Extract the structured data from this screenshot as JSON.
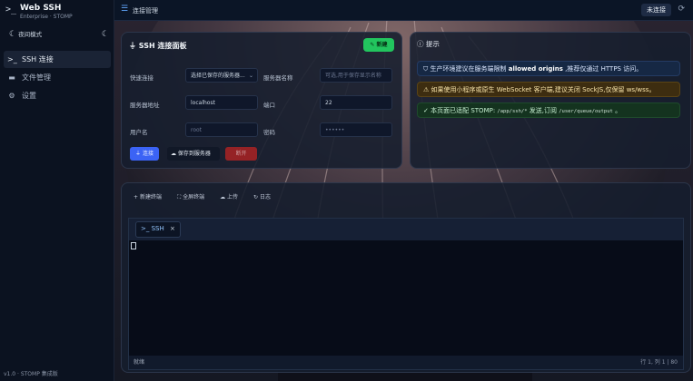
{
  "app": {
    "title": "Web SSH",
    "subtitle": "Enterprise · STOMP",
    "logo_icon": "terminal-icon",
    "theme_label": "夜间模式",
    "version": "v1.0 · STOMP 集成版"
  },
  "sidebar": {
    "items": [
      {
        "label": "SSH 连接",
        "icon": "terminal-icon",
        "glyph": ">_",
        "active": true
      },
      {
        "label": "文件管理",
        "icon": "folder-icon",
        "glyph": "▬",
        "active": false
      },
      {
        "label": "设置",
        "icon": "gear-icon",
        "glyph": "⚙",
        "active": false
      }
    ]
  },
  "header": {
    "title": "连接管理",
    "status": "未连接"
  },
  "ssh_panel": {
    "title": "SSH 连接面板",
    "new_button": "新建",
    "fields": {
      "saved_label": "快速连接",
      "saved_value": "选择已保存的服务器...",
      "alias_label": "服务器名称",
      "alias_placeholder": "可选,用于保存显示名称",
      "host_label": "服务器地址",
      "host_value": "localhost",
      "port_label": "端口",
      "port_value": "22",
      "user_label": "用户名",
      "user_placeholder": "root",
      "password_label": "密码",
      "password_placeholder": "••••••"
    },
    "buttons": {
      "connect": "连接",
      "save": "保存到服务器",
      "disconnect": "断开"
    }
  },
  "tips": {
    "title": "提示",
    "items": [
      {
        "type": "info",
        "prefix": "生产环境建议在服务端限制",
        "strong": "allowed origins",
        "suffix": ",推荐仅通过 HTTPS 访问。"
      },
      {
        "type": "warn",
        "text": "如果使用小程序或原生 WebSocket 客户端,建议关闭 SockJS,仅保留 ws/wss。"
      },
      {
        "type": "ok",
        "prefix": "本页面已适配 STOMP:",
        "code1": "/app/ssh/*",
        "middle": "发送,订阅",
        "code2": "/user/queue/output",
        "suffix": "。"
      }
    ]
  },
  "terminal": {
    "toolbar": [
      {
        "label": "新建终端",
        "glyph": "+",
        "icon": "plus-icon"
      },
      {
        "label": "全屏终端",
        "glyph": "⛶",
        "icon": "fullscreen-icon"
      },
      {
        "label": "上传",
        "glyph": "☁",
        "icon": "upload-icon"
      },
      {
        "label": "日志",
        "glyph": "↻",
        "icon": "history-icon"
      }
    ],
    "tab_label": "SSH",
    "status_left": "就绪",
    "status_right": "行 1, 列 1 | 80"
  }
}
